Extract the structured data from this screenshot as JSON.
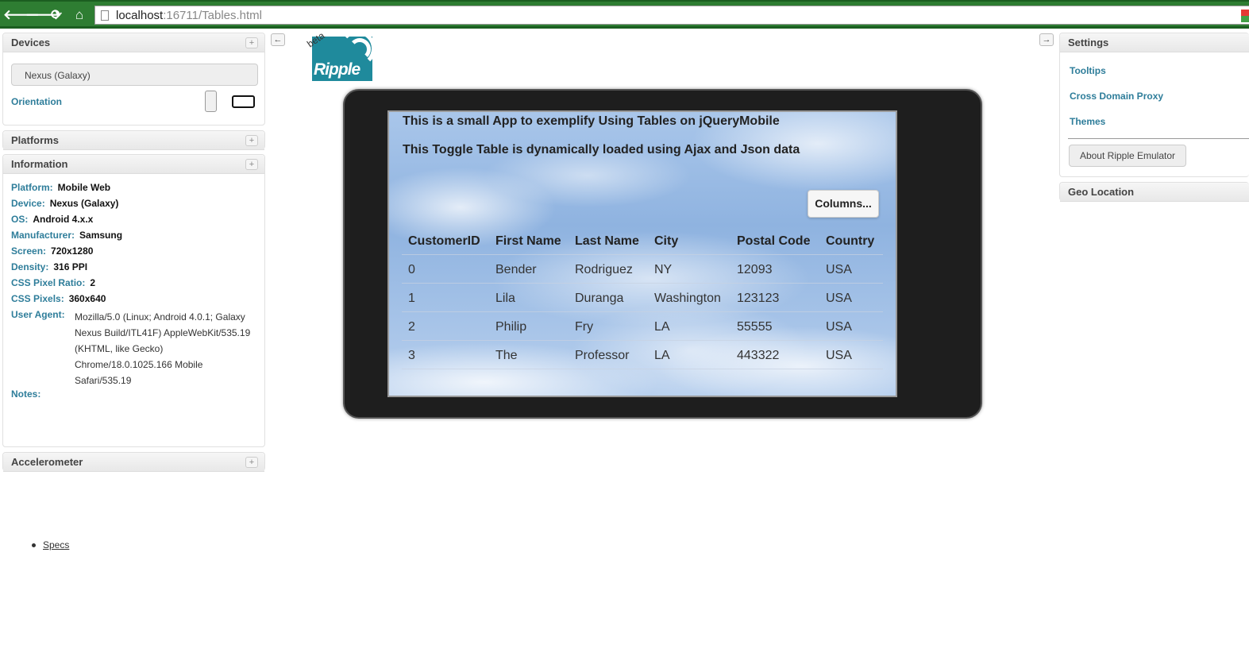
{
  "browser": {
    "url_host": "localhost",
    "url_rest": ":16711/Tables.html"
  },
  "left": {
    "devices": {
      "title": "Devices",
      "selected_device": "Nexus (Galaxy)",
      "orientation_label": "Orientation"
    },
    "platforms": {
      "title": "Platforms"
    },
    "information": {
      "title": "Information",
      "rows": [
        {
          "key": "Platform:",
          "value": "Mobile Web"
        },
        {
          "key": "Device:",
          "value": "Nexus (Galaxy)"
        },
        {
          "key": "OS:",
          "value": "Android 4.x.x"
        },
        {
          "key": "Manufacturer:",
          "value": "Samsung"
        },
        {
          "key": "Screen:",
          "value": "720x1280"
        },
        {
          "key": "Density:",
          "value": "316 PPI"
        },
        {
          "key": "CSS Pixel Ratio:",
          "value": "2"
        },
        {
          "key": "CSS Pixels:",
          "value": "360x640"
        }
      ],
      "user_agent_label": "User Agent:",
      "user_agent_value": "Mozilla/5.0 (Linux; Android 4.0.1; Galaxy Nexus Build/ITL41F) AppleWebKit/535.19 (KHTML, like Gecko) Chrome/18.0.1025.166 Mobile Safari/535.19",
      "notes_label": "Notes:",
      "specs_link": "Specs"
    },
    "accelerometer": {
      "title": "Accelerometer"
    }
  },
  "logo": {
    "text": "Ripple",
    "beta": "beta"
  },
  "app": {
    "heading1": "This is a small App to exemplify Using Tables on jQueryMobile",
    "heading2": "This Toggle Table is dynamically loaded using Ajax and Json data",
    "columns_button": "Columns...",
    "table": {
      "headers": [
        "CustomerID",
        "First Name",
        "Last Name",
        "City",
        "Postal Code",
        "Country"
      ],
      "rows": [
        [
          "0",
          "Bender",
          "Rodriguez",
          "NY",
          "12093",
          "USA"
        ],
        [
          "1",
          "Lila",
          "Duranga",
          "Washington",
          "123123",
          "USA"
        ],
        [
          "2",
          "Philip",
          "Fry",
          "LA",
          "55555",
          "USA"
        ],
        [
          "3",
          "The",
          "Professor",
          "LA",
          "443322",
          "USA"
        ]
      ]
    }
  },
  "right": {
    "settings": {
      "title": "Settings",
      "links": [
        "Tooltips",
        "Cross Domain Proxy",
        "Themes"
      ],
      "about_button": "About Ripple Emulator"
    },
    "geo": {
      "title": "Geo Location"
    }
  }
}
